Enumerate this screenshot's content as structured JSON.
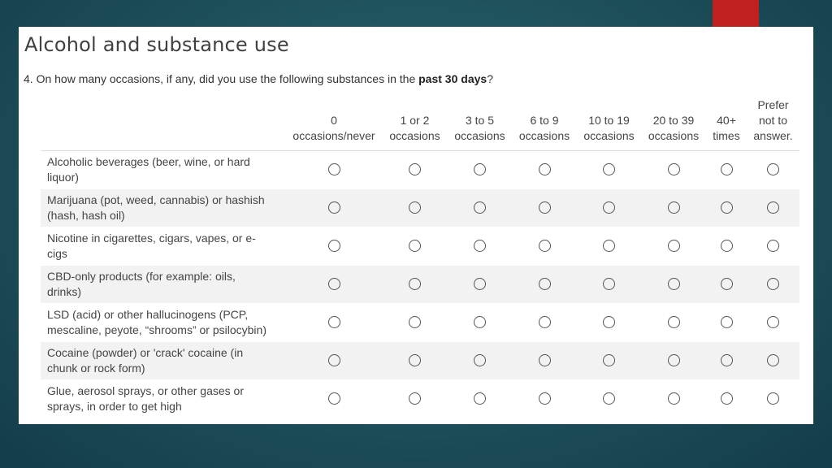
{
  "slide": {
    "title": "Alcohol and substance use",
    "question": {
      "prefix": "4. On how many occasions, if any, did you use the following substances in the ",
      "emphasis": "past 30 days",
      "suffix": "?"
    }
  },
  "grid": {
    "columns": [
      {
        "line1": "",
        "line2": "0",
        "line3": "occasions/never"
      },
      {
        "line1": "",
        "line2": "1 or 2",
        "line3": "occasions"
      },
      {
        "line1": "",
        "line2": "3 to 5",
        "line3": "occasions"
      },
      {
        "line1": "",
        "line2": "6 to 9",
        "line3": "occasions"
      },
      {
        "line1": "",
        "line2": "10 to 19",
        "line3": "occasions"
      },
      {
        "line1": "",
        "line2": "20 to 39",
        "line3": "occasions"
      },
      {
        "line1": "",
        "line2": "40+",
        "line3": "times"
      },
      {
        "line1": "Prefer",
        "line2": "not to",
        "line3": "answer."
      }
    ],
    "rows": [
      {
        "line1": "Alcoholic beverages (beer, wine, or hard",
        "line2": "liquor)"
      },
      {
        "line1": "Marijuana (pot, weed, cannabis) or hashish",
        "line2": "(hash, hash oil)"
      },
      {
        "line1": "Nicotine in cigarettes, cigars, vapes, or e-",
        "line2": "cigs"
      },
      {
        "line1": "CBD-only products (for example: oils,",
        "line2": "drinks)"
      },
      {
        "line1": "LSD (acid) or other hallucinogens (PCP,",
        "line2": "mescaline, peyote, “shrooms” or psilocybin)"
      },
      {
        "line1": "Cocaine (powder) or 'crack' cocaine (in",
        "line2": "chunk or rock form)"
      },
      {
        "line1": "Glue, aerosol sprays, or other gases or",
        "line2": "sprays, in order to get high"
      }
    ]
  },
  "colors": {
    "background": "#1d4f5a",
    "accent": "#c0211f",
    "slide": "#ffffff",
    "row_shade": "#f2f2f2"
  }
}
